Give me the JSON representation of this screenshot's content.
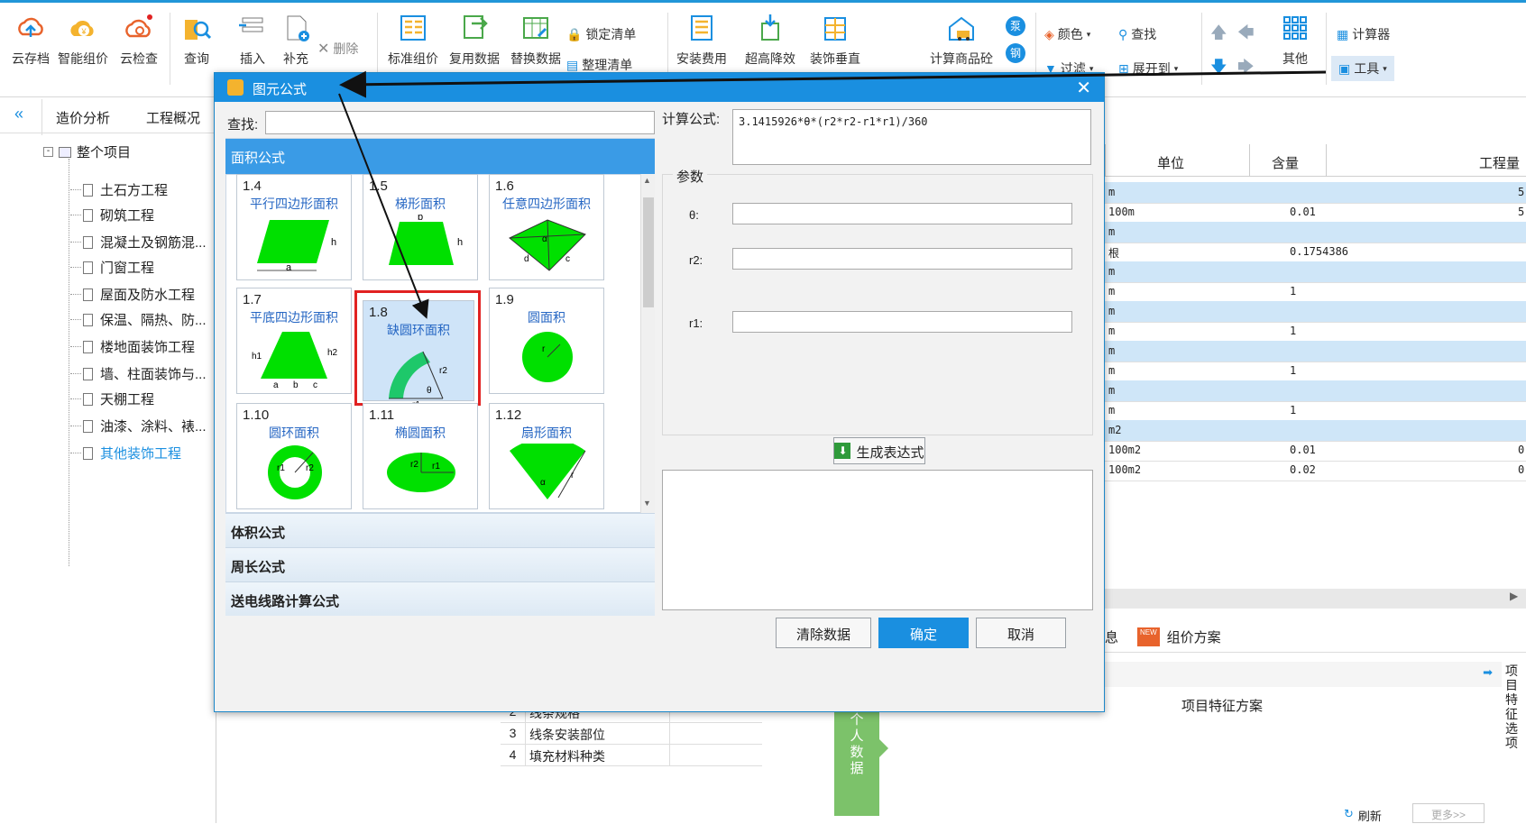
{
  "ribbon": {
    "groups": [
      {
        "label": "云存档"
      },
      {
        "label": "智能组价"
      },
      {
        "label": "云检查"
      },
      {
        "label": "查询"
      },
      {
        "label": "插入"
      },
      {
        "label": "补充"
      },
      {
        "label": "删除"
      },
      {
        "label": "标准组价"
      },
      {
        "label": "复用数据"
      },
      {
        "label": "替换数据"
      },
      {
        "label": "锁定清单"
      },
      {
        "label": "整理清单"
      },
      {
        "label": "安装费用"
      },
      {
        "label": "超高降效"
      },
      {
        "label": "装饰垂直"
      },
      {
        "label": "计算商品砼"
      },
      {
        "label": "颜色"
      },
      {
        "label": "查找"
      },
      {
        "label": "过滤"
      },
      {
        "label": "展开到"
      },
      {
        "label": "其他"
      },
      {
        "label": "计算器"
      },
      {
        "label": "工具"
      }
    ],
    "extra_badges": {
      "b1": "泵",
      "b2": "钢"
    }
  },
  "left": {
    "tabs": [
      "造价分析",
      "工程概况"
    ],
    "root": "整个项目",
    "items": [
      "土石方工程",
      "砌筑工程",
      "混凝土及钢筋混...",
      "门窗工程",
      "屋面及防水工程",
      "保温、隔热、防...",
      "楼地面装饰工程",
      "墙、柱面装饰与...",
      "天棚工程",
      "油漆、涂料、裱...",
      "其他装饰工程"
    ]
  },
  "grid": {
    "headers": {
      "unit": "单位",
      "qty": "含量",
      "amount": "工程量"
    },
    "rows": [
      {
        "unit": "m",
        "qty": "",
        "amt": "5",
        "blue": true
      },
      {
        "unit": "100m",
        "qty": "0.01",
        "amt": "5",
        "blue": false
      },
      {
        "unit": "m",
        "qty": "",
        "amt": "",
        "blue": true
      },
      {
        "unit": "根",
        "qty": "0.1754386",
        "amt": "",
        "blue": false
      },
      {
        "unit": "m",
        "qty": "",
        "amt": "",
        "blue": true
      },
      {
        "unit": "m",
        "qty": "1",
        "amt": "",
        "blue": false
      },
      {
        "unit": "m",
        "qty": "",
        "amt": "",
        "blue": true
      },
      {
        "unit": "m",
        "qty": "1",
        "amt": "",
        "blue": false
      },
      {
        "unit": "m",
        "qty": "",
        "amt": "",
        "blue": true
      },
      {
        "unit": "m",
        "qty": "1",
        "amt": "",
        "blue": false
      },
      {
        "unit": "m",
        "qty": "",
        "amt": "",
        "blue": true
      },
      {
        "unit": "m",
        "qty": "1",
        "amt": "",
        "blue": false
      },
      {
        "unit": "m2",
        "qty": "",
        "amt": "",
        "blue": true
      },
      {
        "unit": "100m2",
        "qty": "0.01",
        "amt": "0",
        "blue": false
      },
      {
        "unit": "100m2",
        "qty": "0.02",
        "amt": "0",
        "blue": false
      }
    ]
  },
  "bottom": {
    "tab_info": "息",
    "tab_scheme": "组价方案",
    "scheme_title": "项目特征方案",
    "rows": [
      {
        "n": "2",
        "t": "线条规格"
      },
      {
        "n": "3",
        "t": "线条安装部位"
      },
      {
        "n": "4",
        "t": "填充材料种类"
      }
    ],
    "personal_data": "个人数据",
    "side_label": "项目特征选项",
    "refresh": "刷新",
    "more": "更多>>"
  },
  "dialog": {
    "title": "图元公式",
    "search_label": "查找:",
    "search_value": "",
    "category_active": "面积公式",
    "categories": [
      "体积公式",
      "周长公式",
      "送电线路计算公式"
    ],
    "formula_label": "计算公式:",
    "formula_value": "3.1415926*θ*(r2*r2-r1*r1)/360",
    "params_label": "参数",
    "params": [
      {
        "name": "θ:",
        "value": ""
      },
      {
        "name": "r2:",
        "value": ""
      },
      {
        "name": "r1:",
        "value": ""
      }
    ],
    "generate_btn": "生成表达式",
    "clear_btn": "清除数据",
    "ok_btn": "确定",
    "cancel_btn": "取消",
    "shapes": [
      {
        "num": "1.4",
        "name": "平行四边形面积"
      },
      {
        "num": "1.5",
        "name": "梯形面积"
      },
      {
        "num": "1.6",
        "name": "任意四边形面积"
      },
      {
        "num": "1.7",
        "name": "平底四边形面积"
      },
      {
        "num": "1.8",
        "name": "缺圆环面积"
      },
      {
        "num": "1.9",
        "name": "圆面积"
      },
      {
        "num": "1.10",
        "name": "圆环面积"
      },
      {
        "num": "1.11",
        "name": "椭圆面积"
      },
      {
        "num": "1.12",
        "name": "扇形面积"
      }
    ],
    "selected_shape": "1.8"
  },
  "colors": {
    "accent": "#1a8fe0",
    "shape_green": "#00e000",
    "select_red": "#e12222"
  }
}
